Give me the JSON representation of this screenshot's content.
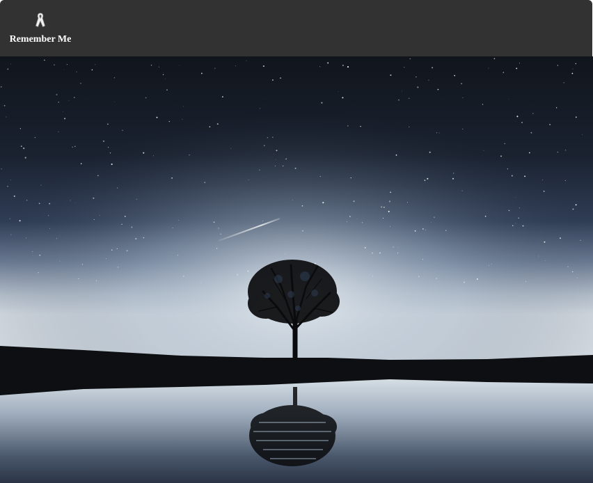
{
  "toolbar": {
    "items": [
      {
        "label": "Remember Me",
        "icon": "awareness-ribbon-icon"
      }
    ]
  },
  "colors": {
    "toolbar_bg": "#323232",
    "label": "#ffffff",
    "sky_top": "#11151c",
    "horizon_glow": "#d9e0e6",
    "ground": "#0d0f12"
  }
}
